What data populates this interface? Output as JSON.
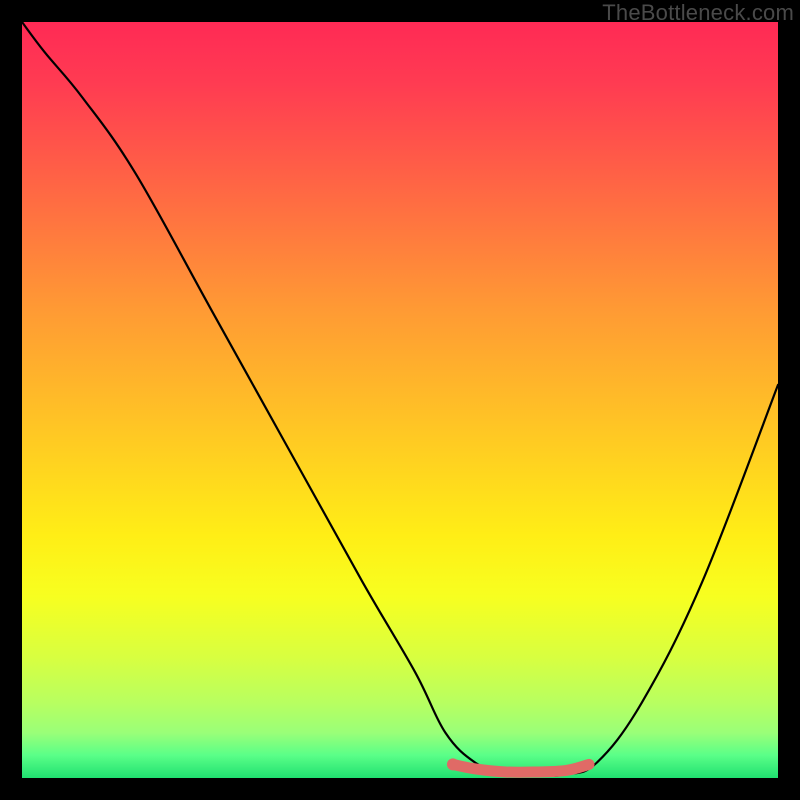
{
  "watermark": "TheBottleneck.com",
  "colors": {
    "background": "#000000",
    "gradient_top": "#ff2a55",
    "gradient_mid": "#ffd220",
    "gradient_bottom": "#20e070",
    "curve": "#000000",
    "highlight_segment": "#e06a66"
  },
  "chart_data": {
    "type": "line",
    "title": "",
    "xlabel": "",
    "ylabel": "",
    "xlim": [
      0,
      100
    ],
    "ylim": [
      0,
      100
    ],
    "grid": false,
    "series": [
      {
        "name": "curve",
        "x": [
          0,
          3,
          8,
          15,
          25,
          35,
          45,
          52,
          56,
          60,
          64,
          68,
          72,
          76,
          82,
          90,
          100
        ],
        "y": [
          100,
          96,
          90,
          80,
          62,
          44,
          26,
          14,
          6,
          2,
          0.5,
          0.3,
          0.5,
          2,
          10,
          26,
          52
        ]
      },
      {
        "name": "highlight-segment",
        "x": [
          57,
          60,
          64,
          68,
          72,
          75
        ],
        "y": [
          1.8,
          1.2,
          0.8,
          0.8,
          1.0,
          1.8
        ]
      },
      {
        "name": "highlight-start-dot",
        "x": [
          57
        ],
        "y": [
          1.8
        ]
      }
    ],
    "annotations": []
  }
}
